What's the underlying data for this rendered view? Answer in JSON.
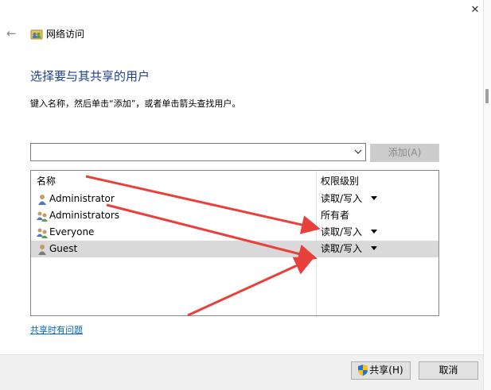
{
  "window": {
    "title": "网络访问",
    "close_glyph": "✕",
    "back_glyph": "←"
  },
  "heading": "选择要与其共享的用户",
  "instruction": "键入名称，然后单击“添加”，或者单击箭头查找用户。",
  "user_input": {
    "value": "",
    "placeholder": ""
  },
  "add_button": "添加(A)",
  "table": {
    "columns": [
      "名称",
      "权限级别"
    ],
    "rows": [
      {
        "name": "Administrator",
        "permission": "读取/写入",
        "has_dropdown": true,
        "icon": "user-icon",
        "selected": false
      },
      {
        "name": "Administrators",
        "permission": "所有者",
        "has_dropdown": false,
        "icon": "user-group-icon",
        "selected": false
      },
      {
        "name": "Everyone",
        "permission": "读取/写入",
        "has_dropdown": true,
        "icon": "user-group-icon",
        "selected": false
      },
      {
        "name": "Guest",
        "permission": "读取/写入",
        "has_dropdown": true,
        "icon": "user-icon",
        "selected": true
      }
    ]
  },
  "help_link": "共享时有问题",
  "footer": {
    "share_button": "共享(H)",
    "cancel_button": "取消"
  },
  "annotation": {
    "arrow_color": "#e8413c"
  }
}
